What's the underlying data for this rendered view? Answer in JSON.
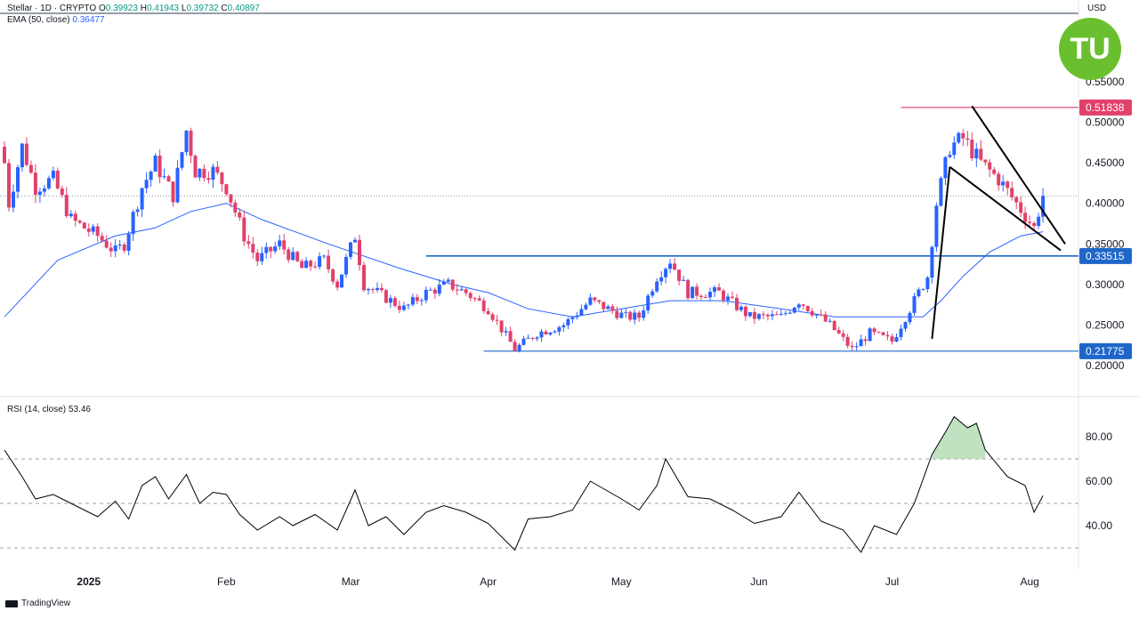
{
  "header": {
    "symbol_line": "Stellar · 1D · CRYPTO",
    "ohlc": {
      "o_label": "O",
      "o": "0.39923",
      "h_label": "H",
      "h": "0.41943",
      "l_label": "L",
      "l": "0.39732",
      "c_label": "C",
      "c": "0.40897"
    },
    "ema_label": "EMA (50, close)",
    "ema_value": "0.36477",
    "currency": "USD"
  },
  "rsi_panel": {
    "label": "RSI (14, close)",
    "value": "53.46"
  },
  "branding": {
    "text": "TradingView",
    "logo_text": "TU"
  },
  "colors": {
    "up": "#2962ff",
    "down": "#e0416a",
    "ema": "#2962ff",
    "resistance": "#e0416a",
    "support": "#1f66c9",
    "rsi_line": "#000000",
    "overbought_fill": "#a5d6a7",
    "logo": "#6abf2e"
  },
  "chart_data": [
    {
      "type": "candlestick",
      "title": "",
      "ylabel": "USD",
      "ylim": [
        0.19,
        0.6
      ],
      "y_ticks": [
        "0.55000",
        "0.50000",
        "0.45000",
        "0.40000",
        "0.35000",
        "0.30000",
        "0.25000",
        "0.20000"
      ],
      "x_labels": [
        "2025",
        "Feb",
        "Mar",
        "Apr",
        "May",
        "Jun",
        "Jul",
        "Aug"
      ],
      "price_tags": [
        {
          "label": "0.51838",
          "kind": "resistance"
        },
        {
          "label": "0.33515",
          "kind": "support"
        },
        {
          "label": "0.21775",
          "kind": "support"
        }
      ],
      "close_path": [
        [
          "2024-12-13",
          0.45
        ],
        [
          "2024-12-14",
          0.4
        ],
        [
          "2024-12-17",
          0.47
        ],
        [
          "2024-12-20",
          0.42
        ],
        [
          "2024-12-24",
          0.43
        ],
        [
          "2024-12-28",
          0.38
        ],
        [
          "2025-01-03",
          0.36
        ],
        [
          "2025-01-07",
          0.34
        ],
        [
          "2025-01-09",
          0.35
        ],
        [
          "2025-01-13",
          0.42
        ],
        [
          "2025-01-16",
          0.45
        ],
        [
          "2025-01-20",
          0.41
        ],
        [
          "2025-01-23",
          0.49
        ],
        [
          "2025-01-25",
          0.44
        ],
        [
          "2025-01-29",
          0.44
        ],
        [
          "2025-02-01",
          0.42
        ],
        [
          "2025-02-05",
          0.36
        ],
        [
          "2025-02-08",
          0.33
        ],
        [
          "2025-02-13",
          0.35
        ],
        [
          "2025-02-18",
          0.32
        ],
        [
          "2025-02-23",
          0.33
        ],
        [
          "2025-02-26",
          0.3
        ],
        [
          "2025-03-02",
          0.36
        ],
        [
          "2025-03-04",
          0.3
        ],
        [
          "2025-03-10",
          0.28
        ],
        [
          "2025-03-13",
          0.27
        ],
        [
          "2025-03-18",
          0.29
        ],
        [
          "2025-03-23",
          0.3
        ],
        [
          "2025-03-27",
          0.29
        ],
        [
          "2025-04-01",
          0.27
        ],
        [
          "2025-04-07",
          0.22
        ],
        [
          "2025-04-12",
          0.24
        ],
        [
          "2025-04-18",
          0.25
        ],
        [
          "2025-04-24",
          0.28
        ],
        [
          "2025-05-02",
          0.26
        ],
        [
          "2025-05-05",
          0.26
        ],
        [
          "2025-05-09",
          0.31
        ],
        [
          "2025-05-12",
          0.33
        ],
        [
          "2025-05-16",
          0.29
        ],
        [
          "2025-05-23",
          0.29
        ],
        [
          "2025-05-30",
          0.26
        ],
        [
          "2025-06-06",
          0.26
        ],
        [
          "2025-06-10",
          0.28
        ],
        [
          "2025-06-17",
          0.25
        ],
        [
          "2025-06-22",
          0.22
        ],
        [
          "2025-06-26",
          0.24
        ],
        [
          "2025-07-01",
          0.23
        ],
        [
          "2025-07-04",
          0.26
        ],
        [
          "2025-07-09",
          0.31
        ],
        [
          "2025-07-11",
          0.4
        ],
        [
          "2025-07-14",
          0.47
        ],
        [
          "2025-07-17",
          0.48
        ],
        [
          "2025-07-21",
          0.45
        ],
        [
          "2025-07-25",
          0.43
        ],
        [
          "2025-07-29",
          0.4
        ],
        [
          "2025-08-02",
          0.37
        ],
        [
          "2025-08-04",
          0.41
        ]
      ],
      "ema_50": [
        [
          "2024-12-13",
          0.26
        ],
        [
          "2024-12-25",
          0.33
        ],
        [
          "2025-01-07",
          0.36
        ],
        [
          "2025-01-16",
          0.37
        ],
        [
          "2025-01-24",
          0.39
        ],
        [
          "2025-02-01",
          0.4
        ],
        [
          "2025-02-09",
          0.38
        ],
        [
          "2025-02-24",
          0.35
        ],
        [
          "2025-03-12",
          0.32
        ],
        [
          "2025-03-24",
          0.3
        ],
        [
          "2025-04-01",
          0.29
        ],
        [
          "2025-04-10",
          0.27
        ],
        [
          "2025-04-20",
          0.26
        ],
        [
          "2025-05-01",
          0.27
        ],
        [
          "2025-05-12",
          0.28
        ],
        [
          "2025-05-24",
          0.28
        ],
        [
          "2025-06-06",
          0.27
        ],
        [
          "2025-06-18",
          0.26
        ],
        [
          "2025-07-01",
          0.26
        ],
        [
          "2025-07-08",
          0.26
        ],
        [
          "2025-07-12",
          0.28
        ],
        [
          "2025-07-17",
          0.31
        ],
        [
          "2025-07-23",
          0.34
        ],
        [
          "2025-07-30",
          0.36
        ],
        [
          "2025-08-04",
          0.365
        ]
      ],
      "resistance": {
        "y": 0.51838,
        "from": "2025-07-03",
        "to": "2025-08-11"
      },
      "support_lines": [
        {
          "y": 0.33515,
          "from": "2025-03-18",
          "to": "2025-08-11"
        },
        {
          "y": 0.21775,
          "from": "2025-03-31",
          "to": "2025-08-11"
        }
      ],
      "pattern_lines": [
        {
          "from": [
            "2025-07-10",
            0.233
          ],
          "to": [
            "2025-07-14",
            0.445
          ]
        },
        {
          "from": [
            "2025-07-14",
            0.445
          ],
          "to": [
            "2025-08-08",
            0.342
          ]
        },
        {
          "from": [
            "2025-07-19",
            0.52
          ],
          "to": [
            "2025-08-09",
            0.35
          ]
        }
      ]
    },
    {
      "type": "line",
      "title": "RSI (14, close)",
      "ylim": [
        24,
        96
      ],
      "y_ticks": [
        "80.00",
        "60.00",
        "40.00"
      ],
      "levels": [
        70,
        50,
        30
      ],
      "series": [
        {
          "values": [
            [
              "2024-12-13",
              74
            ],
            [
              "2024-12-17",
              62
            ],
            [
              "2024-12-20",
              52
            ],
            [
              "2024-12-24",
              54
            ],
            [
              "2024-12-28",
              50
            ],
            [
              "2025-01-03",
              44
            ],
            [
              "2025-01-07",
              51
            ],
            [
              "2025-01-10",
              43
            ],
            [
              "2025-01-13",
              58
            ],
            [
              "2025-01-16",
              62
            ],
            [
              "2025-01-19",
              52
            ],
            [
              "2025-01-23",
              63
            ],
            [
              "2025-01-26",
              50
            ],
            [
              "2025-01-29",
              55
            ],
            [
              "2025-02-01",
              54
            ],
            [
              "2025-02-04",
              45
            ],
            [
              "2025-02-08",
              38
            ],
            [
              "2025-02-13",
              44
            ],
            [
              "2025-02-16",
              40
            ],
            [
              "2025-02-21",
              45
            ],
            [
              "2025-02-26",
              38
            ],
            [
              "2025-03-02",
              56
            ],
            [
              "2025-03-05",
              40
            ],
            [
              "2025-03-09",
              44
            ],
            [
              "2025-03-13",
              36
            ],
            [
              "2025-03-18",
              46
            ],
            [
              "2025-03-22",
              49
            ],
            [
              "2025-03-27",
              46
            ],
            [
              "2025-04-01",
              41
            ],
            [
              "2025-04-07",
              29
            ],
            [
              "2025-04-10",
              43
            ],
            [
              "2025-04-15",
              44
            ],
            [
              "2025-04-20",
              47
            ],
            [
              "2025-04-24",
              60
            ],
            [
              "2025-05-01",
              52
            ],
            [
              "2025-05-05",
              47
            ],
            [
              "2025-05-09",
              58
            ],
            [
              "2025-05-11",
              70
            ],
            [
              "2025-05-16",
              53
            ],
            [
              "2025-05-21",
              52
            ],
            [
              "2025-05-26",
              47
            ],
            [
              "2025-05-31",
              41
            ],
            [
              "2025-06-06",
              44
            ],
            [
              "2025-06-10",
              55
            ],
            [
              "2025-06-15",
              42
            ],
            [
              "2025-06-20",
              38
            ],
            [
              "2025-06-24",
              28
            ],
            [
              "2025-06-27",
              40
            ],
            [
              "2025-07-02",
              36
            ],
            [
              "2025-07-06",
              50
            ],
            [
              "2025-07-10",
              72
            ],
            [
              "2025-07-13",
              82
            ],
            [
              "2025-07-15",
              89
            ],
            [
              "2025-07-18",
              84
            ],
            [
              "2025-07-20",
              86
            ],
            [
              "2025-07-22",
              74
            ],
            [
              "2025-07-27",
              62
            ],
            [
              "2025-07-31",
              58
            ],
            [
              "2025-08-02",
              46
            ],
            [
              "2025-08-04",
              53.46
            ]
          ]
        }
      ]
    }
  ]
}
